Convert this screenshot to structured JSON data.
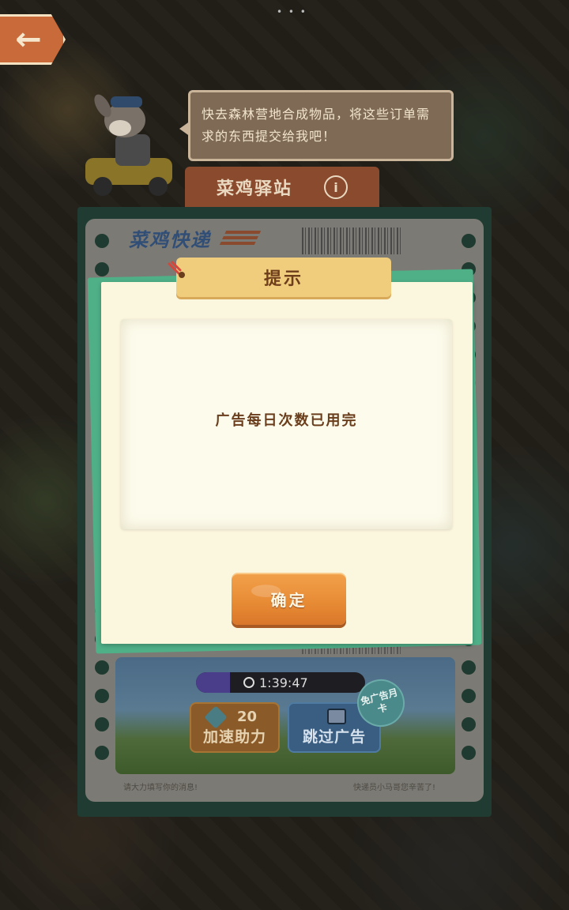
{
  "top_bar": {
    "back_label": "←"
  },
  "npc": {
    "speech": "快去森林营地合成物品，将这些订单需求的东西提交给我吧！"
  },
  "station": {
    "title": "菜鸡驿站",
    "info_label": "i"
  },
  "ticket": {
    "brand": "菜鸡快递",
    "timer": "1:39:47",
    "timer_progress": 0.2,
    "speedup_count": "20",
    "speedup_label": "加速助力",
    "skip_ad_label": "跳过广告",
    "badge": "免广告月卡",
    "footer_left": "请大力填写你的消息!",
    "footer_right": "快递员小马哥您辛苦了!"
  },
  "dialog": {
    "title": "提示",
    "message": "广告每日次数已用完",
    "confirm_label": "确定"
  }
}
